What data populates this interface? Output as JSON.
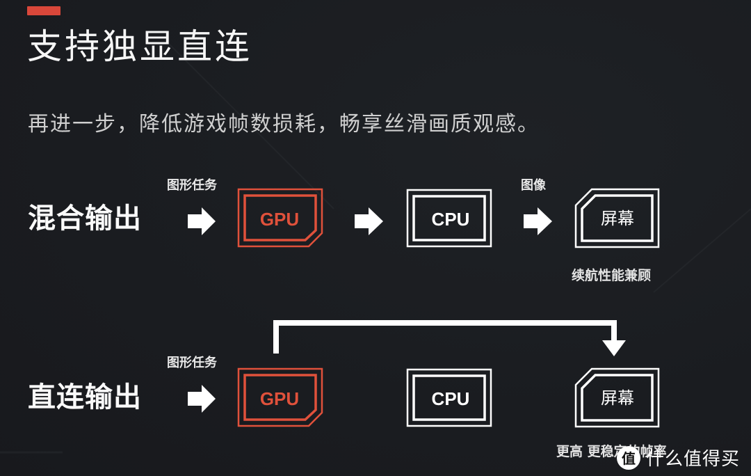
{
  "header": {
    "title": "支持独显直连",
    "subtitle": "再进一步，降低游戏帧数损耗，畅享丝滑画质观感。"
  },
  "colors": {
    "accent": "#d9473a",
    "gpu": "#e0513b",
    "foreground": "#ffffff",
    "background": "#1a1c20"
  },
  "rows": [
    {
      "label": "混合输出",
      "input_label": "图形任务",
      "gpu_label": "GPU",
      "cpu_label": "CPU",
      "image_label": "图像",
      "screen_label": "屏幕",
      "note": "续航性能兼顾"
    },
    {
      "label": "直连输出",
      "input_label": "图形任务",
      "gpu_label": "GPU",
      "cpu_label": "CPU",
      "screen_label": "屏幕",
      "note": "更高 更稳定的帧率"
    }
  ],
  "icons": {
    "arrow": "right-arrow-icon",
    "bypass": "bypass-arrow-icon"
  },
  "watermark": {
    "logo_char": "值",
    "text": "什么值得买"
  }
}
